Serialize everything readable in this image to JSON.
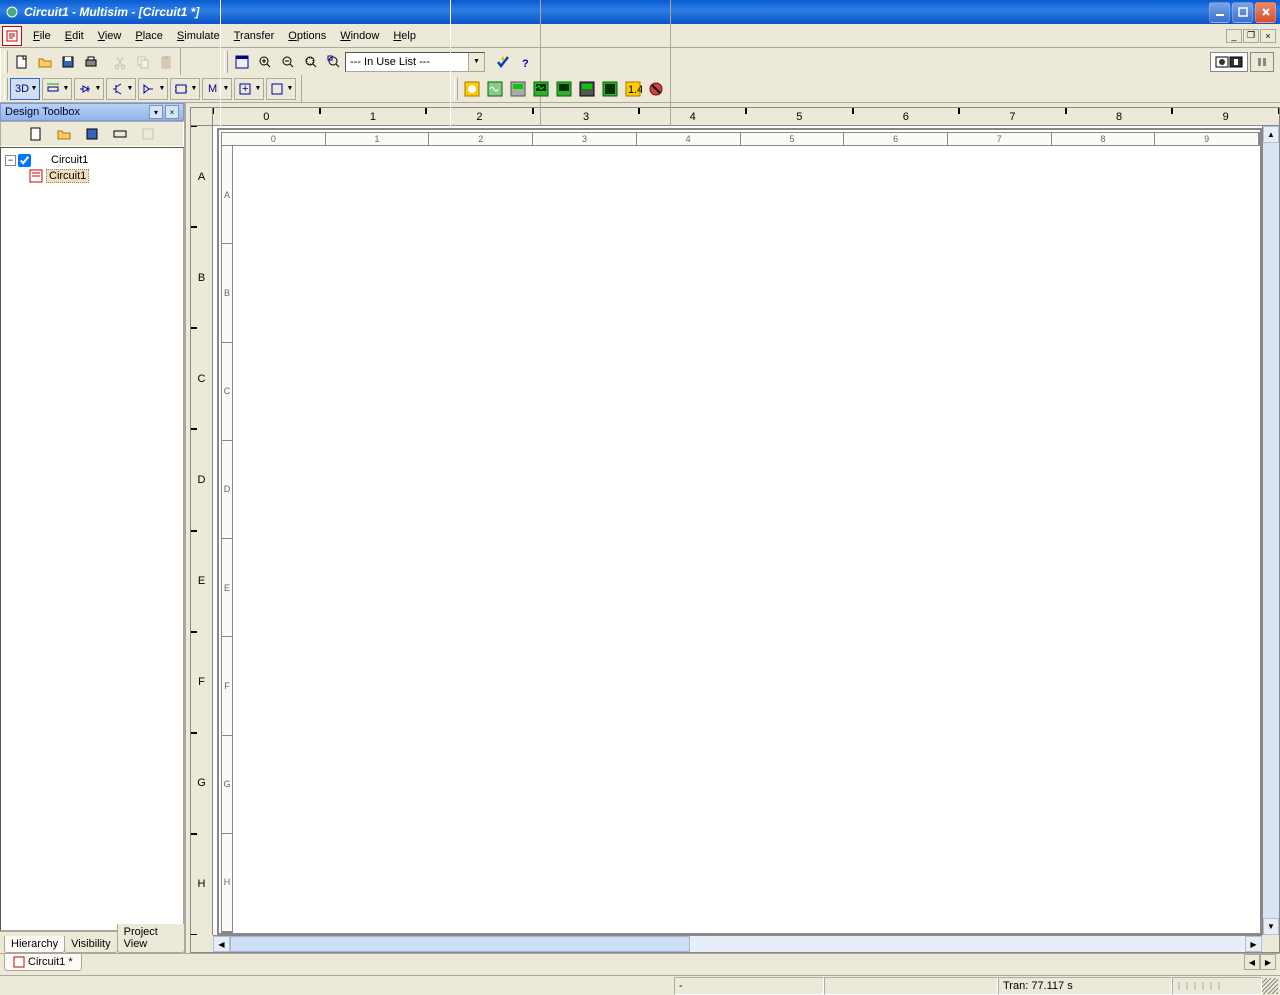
{
  "title": "Circuit1 - Multisim - [Circuit1 *]",
  "menus": [
    "File",
    "Edit",
    "View",
    "Place",
    "Simulate",
    "Transfer",
    "Options",
    "Window",
    "Help"
  ],
  "menu_first_letters": [
    "F",
    "E",
    "V",
    "P",
    "S",
    "T",
    "O",
    "W",
    "H"
  ],
  "combo_value": "--- In Use List ---",
  "sidebar": {
    "title": "Design Toolbox",
    "tree": {
      "root": "Circuit1",
      "child": "Circuit1"
    },
    "tabs": [
      "Hierarchy",
      "Visibility",
      "Project View"
    ],
    "active_tab": 0
  },
  "ruler_cols": [
    "0",
    "1",
    "2",
    "3",
    "4",
    "5",
    "6",
    "7",
    "8",
    "9"
  ],
  "ruler_rows": [
    "A",
    "B",
    "C",
    "D",
    "E",
    "F",
    "G",
    "H"
  ],
  "doc_tab": "Circuit1 *",
  "status": {
    "coord": "-",
    "sim": "Tran: 77.117 s"
  }
}
